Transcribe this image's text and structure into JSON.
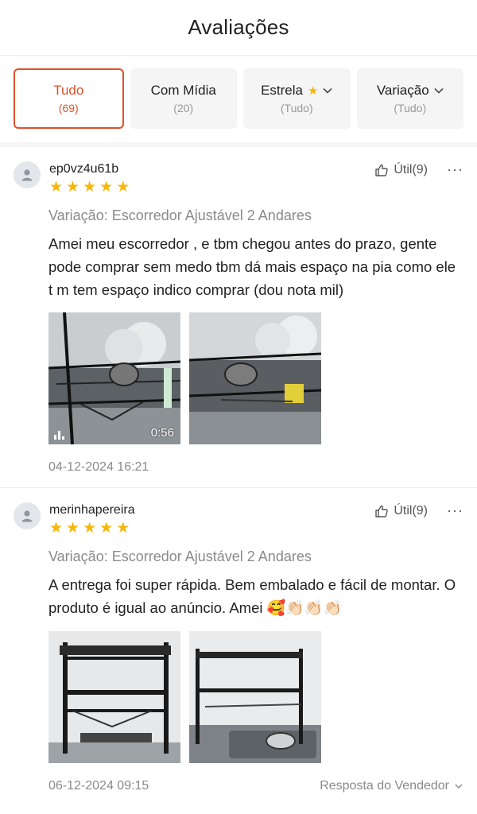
{
  "header": {
    "title": "Avaliações"
  },
  "filters": [
    {
      "label": "Tudo",
      "sub": "(69)"
    },
    {
      "label": "Com Mídia",
      "sub": "(20)"
    },
    {
      "label": "Estrela",
      "sub": "(Tudo)"
    },
    {
      "label": "Variação",
      "sub": "(Tudo)"
    }
  ],
  "colors": {
    "accent": "#e0502a",
    "star": "#f5b70a"
  },
  "reviews": [
    {
      "username": "ep0vz4u61b",
      "rating": 5,
      "helpful": "Útil(9)",
      "more": "···",
      "variation": "Variação: Escorredor Ajustável 2 Andares",
      "text": "Amei meu escorredor  , e tbm chegou  antes do prazo, gente pode comprar  sem medo tbm dá  mais espaço  na pia como ele  t m tem espaço  indico  comprar (dou nota mil)",
      "video_duration": "0:56",
      "date": "04-12-2024 16:21"
    },
    {
      "username": "merinhapereira",
      "rating": 5,
      "helpful": "Útil(9)",
      "more": "···",
      "variation": "Variação: Escorredor Ajustável 2 Andares",
      "text": "A entrega foi super rápida. Bem embalado e fácil de montar. O produto é igual ao anúncio. Amei ",
      "emojis": "🥰👏🏻👏🏻👏🏻",
      "date": "06-12-2024 09:15",
      "seller_reply": "Resposta do Vendedor"
    }
  ]
}
